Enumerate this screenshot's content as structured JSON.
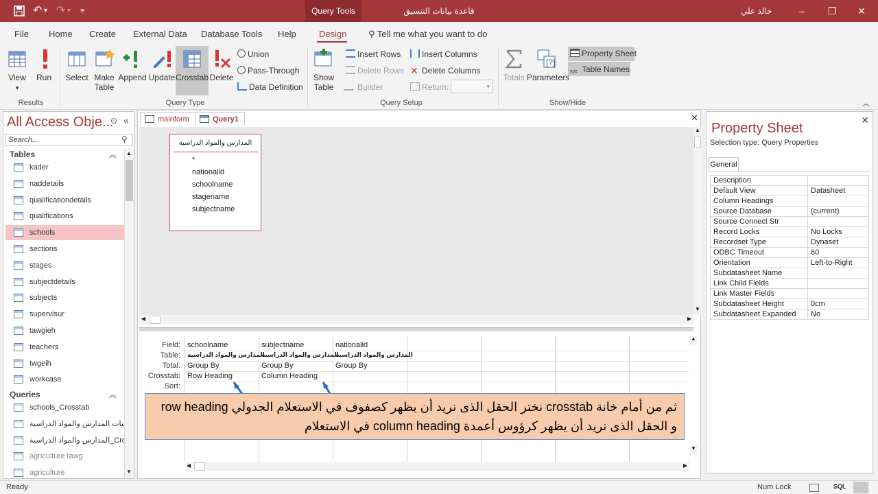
{
  "title_bar": {
    "context_tab": "Query Tools",
    "app_title": "قاعدة بيانات التنسيق",
    "user": "خالد علي"
  },
  "menu": {
    "tabs": [
      "File",
      "Home",
      "Create",
      "External Data",
      "Database Tools",
      "Help",
      "Design"
    ],
    "tell_me": "Tell me what you want to do"
  },
  "ribbon": {
    "results": {
      "label": "Results",
      "view": "View",
      "run": "Run"
    },
    "query_type": {
      "label": "Query Type",
      "select": "Select",
      "make_table": "Make Table",
      "append": "Append",
      "update": "Update",
      "crosstab": "Crosstab",
      "delete": "Delete",
      "union": "Union",
      "pass_through": "Pass-Through",
      "data_definition": "Data Definition"
    },
    "query_setup": {
      "label": "Query Setup",
      "show_table": "Show Table",
      "insert_rows": "Insert Rows",
      "delete_rows": "Delete Rows",
      "builder": "Builder",
      "insert_columns": "Insert Columns",
      "delete_columns": "Delete Columns",
      "return": "Return:"
    },
    "show_hide": {
      "label": "Show/Hide",
      "totals": "Totals",
      "parameters": "Parameters",
      "property_sheet": "Property Sheet",
      "table_names": "Table Names"
    }
  },
  "nav": {
    "title": "All Access Obje...",
    "search_placeholder": "Search...",
    "tables_header": "Tables",
    "tables": [
      "kader",
      "naddetails",
      "qualificationdetails",
      "qualifications",
      "schools",
      "sections",
      "stages",
      "subjectdetails",
      "subjects",
      "supervisur",
      "tawgieh",
      "teachers",
      "twgeih",
      "workcase"
    ],
    "queries_header": "Queries",
    "queries": [
      "schools_Crosstab",
      "احصائيات المدارس والمواد الدراسية",
      "المدارس والمواد الدراسية_Crosst...",
      "agriculture tawg",
      "agriculture"
    ]
  },
  "doc": {
    "tabs": [
      "mainform",
      "Query1"
    ],
    "table_box": {
      "title": "المدارس والمواد الدراسية",
      "fields": [
        "*",
        "nationalid",
        "schoolname",
        "stagename",
        "subjectname"
      ]
    },
    "grid": {
      "row_labels": [
        "Field:",
        "Table:",
        "Total:",
        "Crosstab:",
        "Sort:"
      ],
      "columns": [
        {
          "field": "schoolname",
          "table": "المدارس والمواد الدراسية",
          "total": "Group By",
          "crosstab": "Row Heading"
        },
        {
          "field": "subjectname",
          "table": "المدارس والمواد الدراسية",
          "total": "Group By",
          "crosstab": "Column Heading"
        },
        {
          "field": "nationalid",
          "table": "المدارس والمواد الدراسية",
          "total": "Group By",
          "crosstab": ""
        }
      ]
    },
    "callout": "ثم من أمام خانة crosstab نختر الحقل الذى نريد أن يظهر كصفوف في الاستعلام الجدولي row heading و الحقل الذى نريد أن يظهر كرؤوس أعمدة column heading في الاستعلام"
  },
  "property_sheet": {
    "title": "Property Sheet",
    "selection_type": "Selection type:  Query Properties",
    "tab": "General",
    "rows": [
      [
        "Description",
        ""
      ],
      [
        "Default View",
        "Datasheet"
      ],
      [
        "Column Headings",
        ""
      ],
      [
        "Source Database",
        "(current)"
      ],
      [
        "Source Connect Str",
        ""
      ],
      [
        "Record Locks",
        "No Locks"
      ],
      [
        "Recordset Type",
        "Dynaset"
      ],
      [
        "ODBC Timeout",
        "60"
      ],
      [
        "Orientation",
        "Left-to-Right"
      ],
      [
        "Subdatasheet Name",
        ""
      ],
      [
        "Link Child Fields",
        ""
      ],
      [
        "Link Master Fields",
        ""
      ],
      [
        "Subdatasheet Height",
        "0cm"
      ],
      [
        "Subdatasheet Expanded",
        "No"
      ]
    ]
  },
  "status": {
    "left": "Ready",
    "num_lock": "Num Lock",
    "sql": "SQL"
  },
  "colors": {
    "accent": "#a4373a",
    "selection": "#f6c4c4",
    "callout_bg": "#f8cbad",
    "callout_border": "#5b8ec9"
  }
}
